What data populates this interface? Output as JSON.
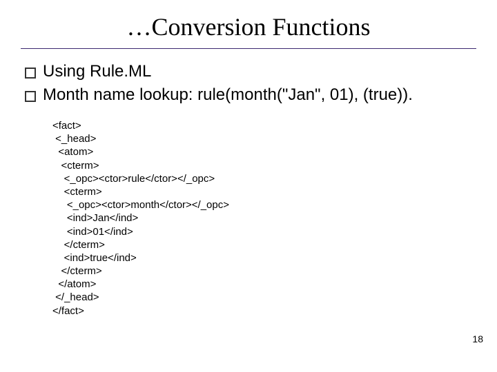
{
  "title": "…Conversion Functions",
  "bullets": [
    "Using Rule.ML",
    "Month name lookup: rule(month(\"Jan\", 01), (true))."
  ],
  "code": "<fact>\n <_head>\n  <atom>\n   <cterm>\n    <_opc><ctor>rule</ctor></_opc>\n    <cterm>\n     <_opc><ctor>month</ctor></_opc>\n     <ind>Jan</ind>\n     <ind>01</ind>\n    </cterm>\n    <ind>true</ind>\n   </cterm>\n  </atom>\n </_head>\n</fact>",
  "page_number": "18"
}
